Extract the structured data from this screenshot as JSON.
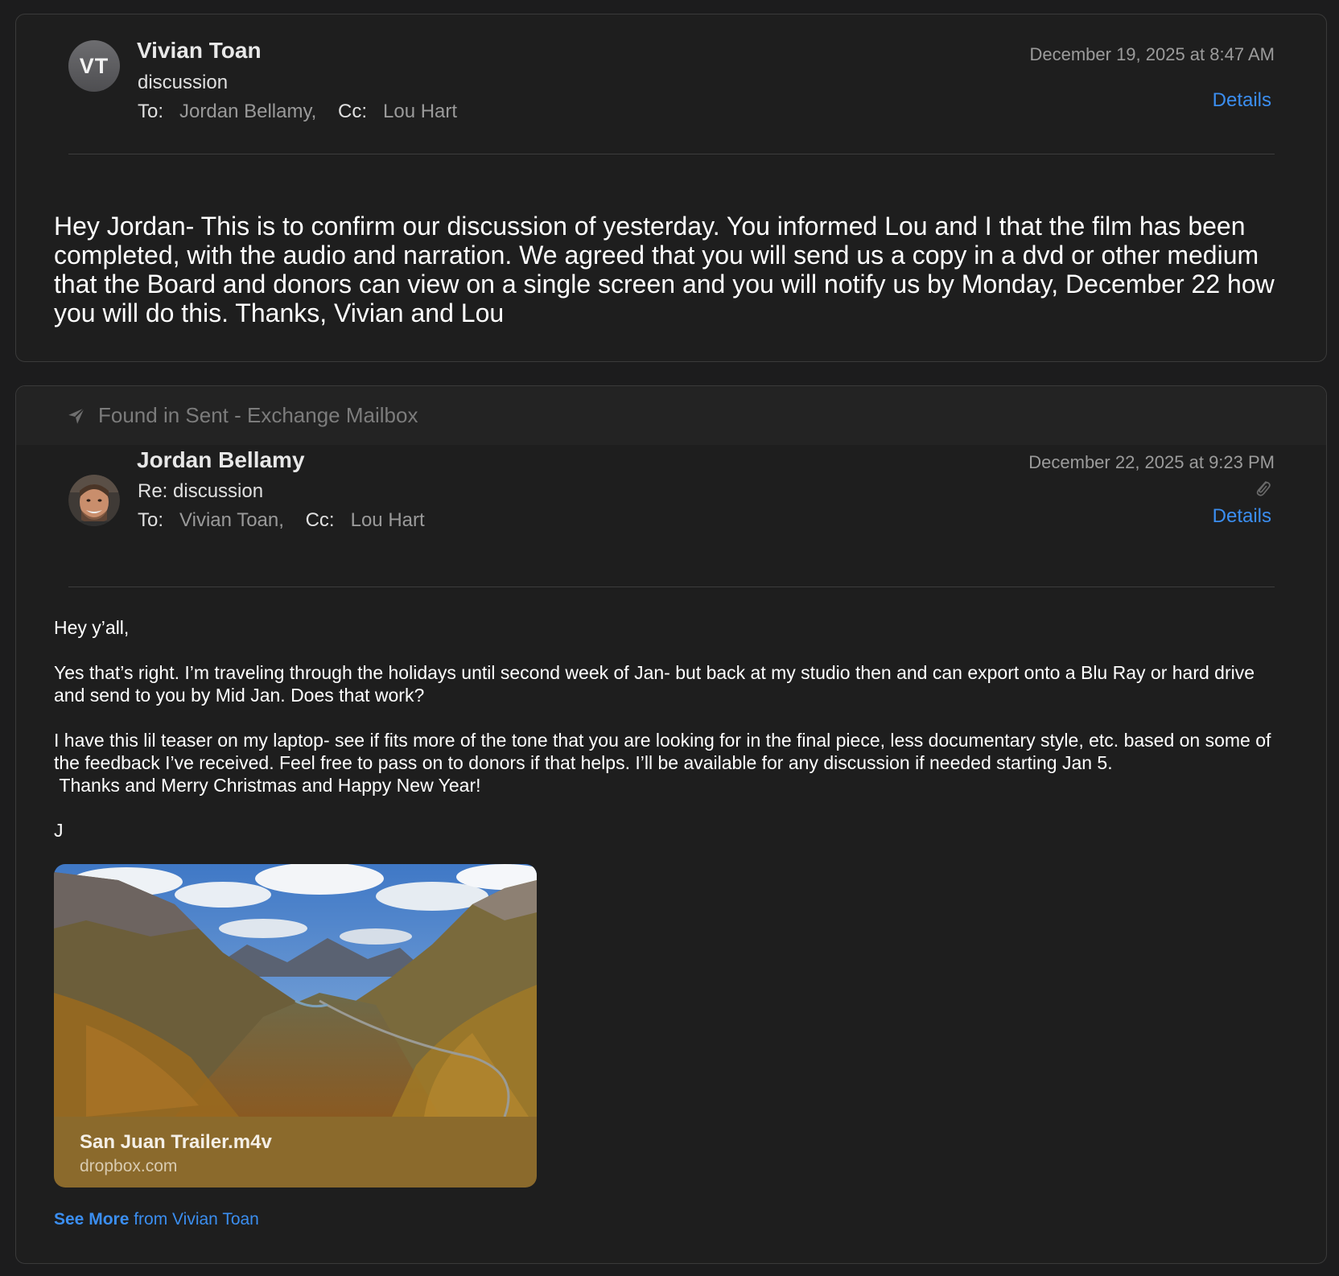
{
  "messages": [
    {
      "avatar_initials": "VT",
      "sender": "Vivian Toan",
      "subject": "discussion",
      "to_label": "To:",
      "to": "Jordan Bellamy,",
      "cc_label": "Cc:",
      "cc": "Lou Hart",
      "date": "December 19, 2025 at 8:47 AM",
      "details_label": "Details",
      "body": "Hey Jordan-  This is to confirm our discussion of yesterday.   You informed Lou and I that the film has been completed, with the audio and narration.   We agreed that you will send us a copy in  a dvd or other medium that the Board and donors can view on a single screen and you will notify us by Monday, December 22  how you will do this.  Thanks,  Vivian and Lou"
    },
    {
      "found_in": "Found in Sent - Exchange Mailbox",
      "sender": "Jordan Bellamy",
      "subject": "Re: discussion",
      "to_label": "To:",
      "to": "Vivian Toan,",
      "cc_label": "Cc:",
      "cc": "Lou Hart",
      "date": "December 22, 2025 at 9:23 PM",
      "details_label": "Details",
      "body": {
        "greeting": "Hey y’all,",
        "para1": "Yes that’s right. I’m traveling through the holidays until second week of Jan- but back at my studio then and can export onto a Blu Ray or hard drive and send to you by Mid Jan. Does that work?",
        "para2": "I have this lil teaser on my laptop- see if fits more of the tone that you are looking for in the final piece, less documentary style, etc. based on some of the feedback I’ve received. Feel free to pass on to donors if that helps. I’ll be available for any discussion if needed starting Jan 5.\n Thanks and Merry Christmas and Happy New Year!",
        "signoff": "J"
      },
      "attachment": {
        "name": "San Juan Trailer.m4v",
        "domain": "dropbox.com"
      },
      "see_more": {
        "bold": "See More",
        "rest": " from Vivian Toan"
      }
    }
  ],
  "colors": {
    "background": "#1c1c1d",
    "card": "#1e1e1e",
    "link": "#3b8ef0",
    "attachment_footer": "#8b6a2c"
  },
  "icons": [
    "paper-plane-icon",
    "paperclip-icon"
  ]
}
